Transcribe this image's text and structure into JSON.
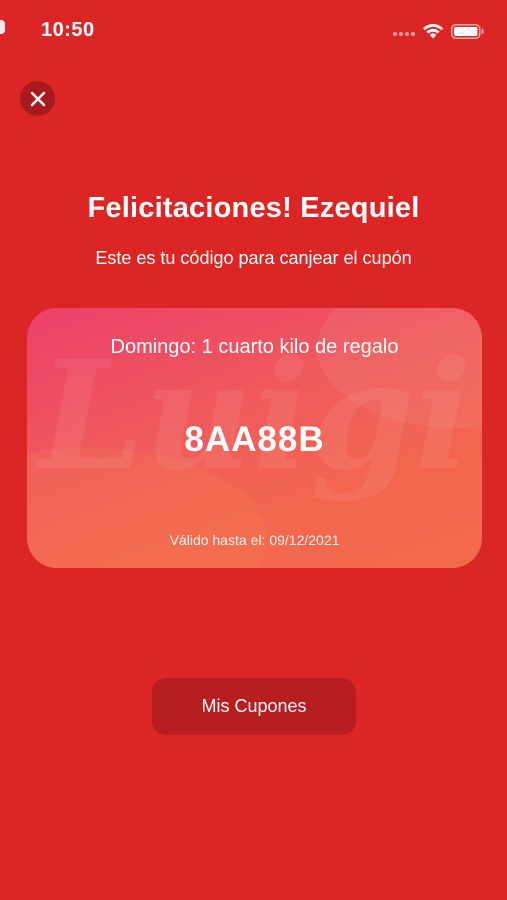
{
  "status_bar": {
    "time": "10:50"
  },
  "header": {
    "title": "Felicitaciones! Ezequiel",
    "subtitle": "Este es tu código para canjear el cupón"
  },
  "coupon": {
    "description": "Domingo: 1 cuarto kilo de regalo",
    "code": "8AA88B",
    "valid_label": "Válido hasta el:",
    "valid_date": "09/12/2021",
    "watermark": "Luigi"
  },
  "actions": {
    "my_coupons_label": "Mis Cupones"
  },
  "colors": {
    "background": "#dc2626",
    "button": "#b81d22",
    "close_button": "#a81a1e"
  },
  "icons": {
    "close": "close-icon",
    "wifi": "wifi-icon",
    "battery": "battery-icon"
  }
}
